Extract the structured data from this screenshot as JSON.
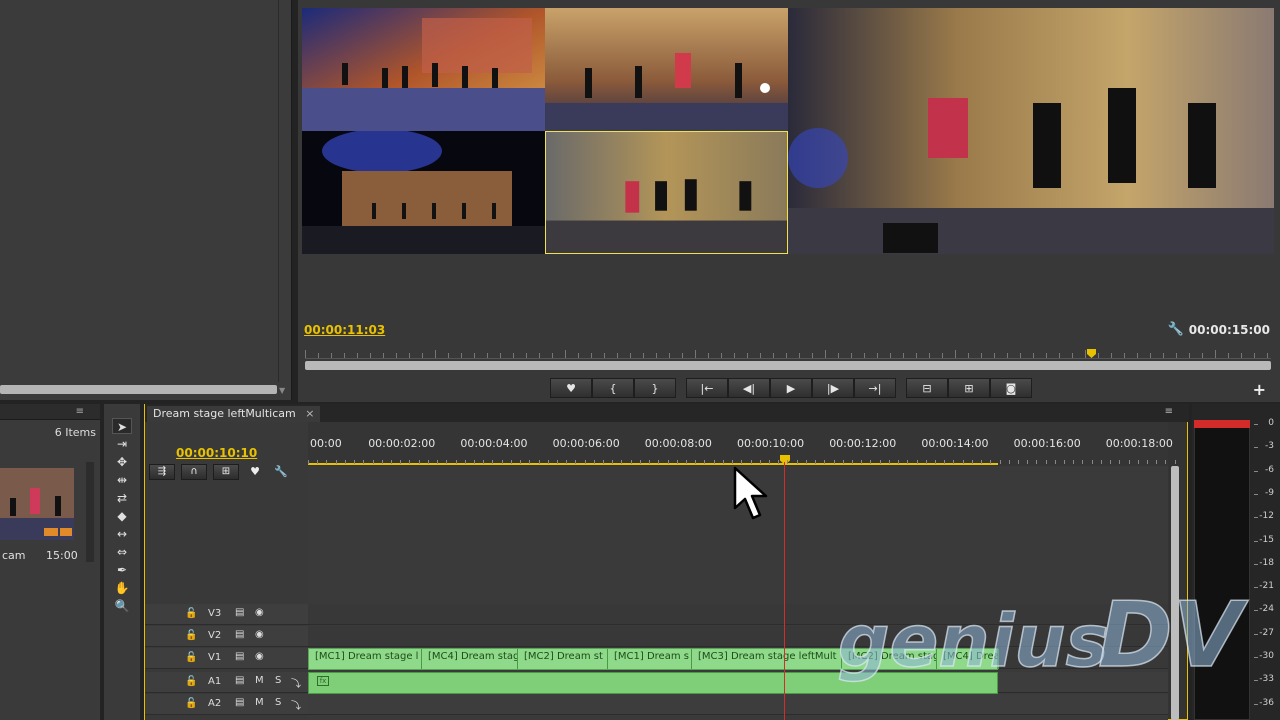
{
  "monitor": {
    "current_timecode": "00:00:11:03",
    "duration_timecode": "00:00:15:00",
    "controls": [
      {
        "name": "add-marker-button",
        "glyph": "♥"
      },
      {
        "name": "mark-in-button",
        "glyph": "{"
      },
      {
        "name": "mark-out-button",
        "glyph": "}"
      },
      {
        "name": "go-to-in-button",
        "glyph": "|←"
      },
      {
        "name": "step-back-button",
        "glyph": "◀|"
      },
      {
        "name": "play-button",
        "glyph": "▶"
      },
      {
        "name": "step-forward-button",
        "glyph": "|▶"
      },
      {
        "name": "go-to-out-button",
        "glyph": "→|"
      },
      {
        "name": "lift-button",
        "glyph": "⊟"
      },
      {
        "name": "extract-button",
        "glyph": "⊞"
      },
      {
        "name": "export-frame-button",
        "glyph": "◙"
      }
    ],
    "plus_label": "+",
    "wrench_icon": "wrench-icon"
  },
  "project": {
    "items_count": "6 Items",
    "item_name": "cam",
    "item_duration": "15:00"
  },
  "tools": [
    "selection-tool",
    "track-select-tool",
    "ripple-edit-tool",
    "rolling-edit-tool",
    "rate-stretch-tool",
    "razor-tool",
    "slip-tool",
    "slide-tool",
    "pen-tool",
    "hand-tool",
    "zoom-tool"
  ],
  "timeline": {
    "tab_label": "Dream stage leftMulticam",
    "tab_close": "×",
    "current_timecode": "00:00:10:10",
    "ruler_labels": [
      "00:00",
      "00:00:02:00",
      "00:00:04:00",
      "00:00:06:00",
      "00:00:08:00",
      "00:00:10:00",
      "00:00:12:00",
      "00:00:14:00",
      "00:00:16:00",
      "00:00:18:00"
    ],
    "tracks": [
      {
        "name": "V3"
      },
      {
        "name": "V2"
      },
      {
        "name": "V1"
      },
      {
        "name": "A1"
      },
      {
        "name": "A2"
      }
    ],
    "v1_clips": [
      "[MC1] Dream stage l",
      "[MC4] Dream stag",
      "[MC2] Dream st",
      "[MC1] Dream s",
      "[MC3] Dream stage leftMult",
      "[MC2] Dream stag",
      "[MC4] Drea"
    ],
    "fx_badge": "fx"
  },
  "meter": {
    "db_labels": [
      "0",
      "-3",
      "-6",
      "-9",
      "-12",
      "-15",
      "-18",
      "-21",
      "-24",
      "-27",
      "-30",
      "-33",
      "-36"
    ]
  },
  "colors": {
    "accent_yellow": "#e8c200",
    "clip_green": "#8fd98a",
    "playhead_red": "#d42b2b"
  }
}
